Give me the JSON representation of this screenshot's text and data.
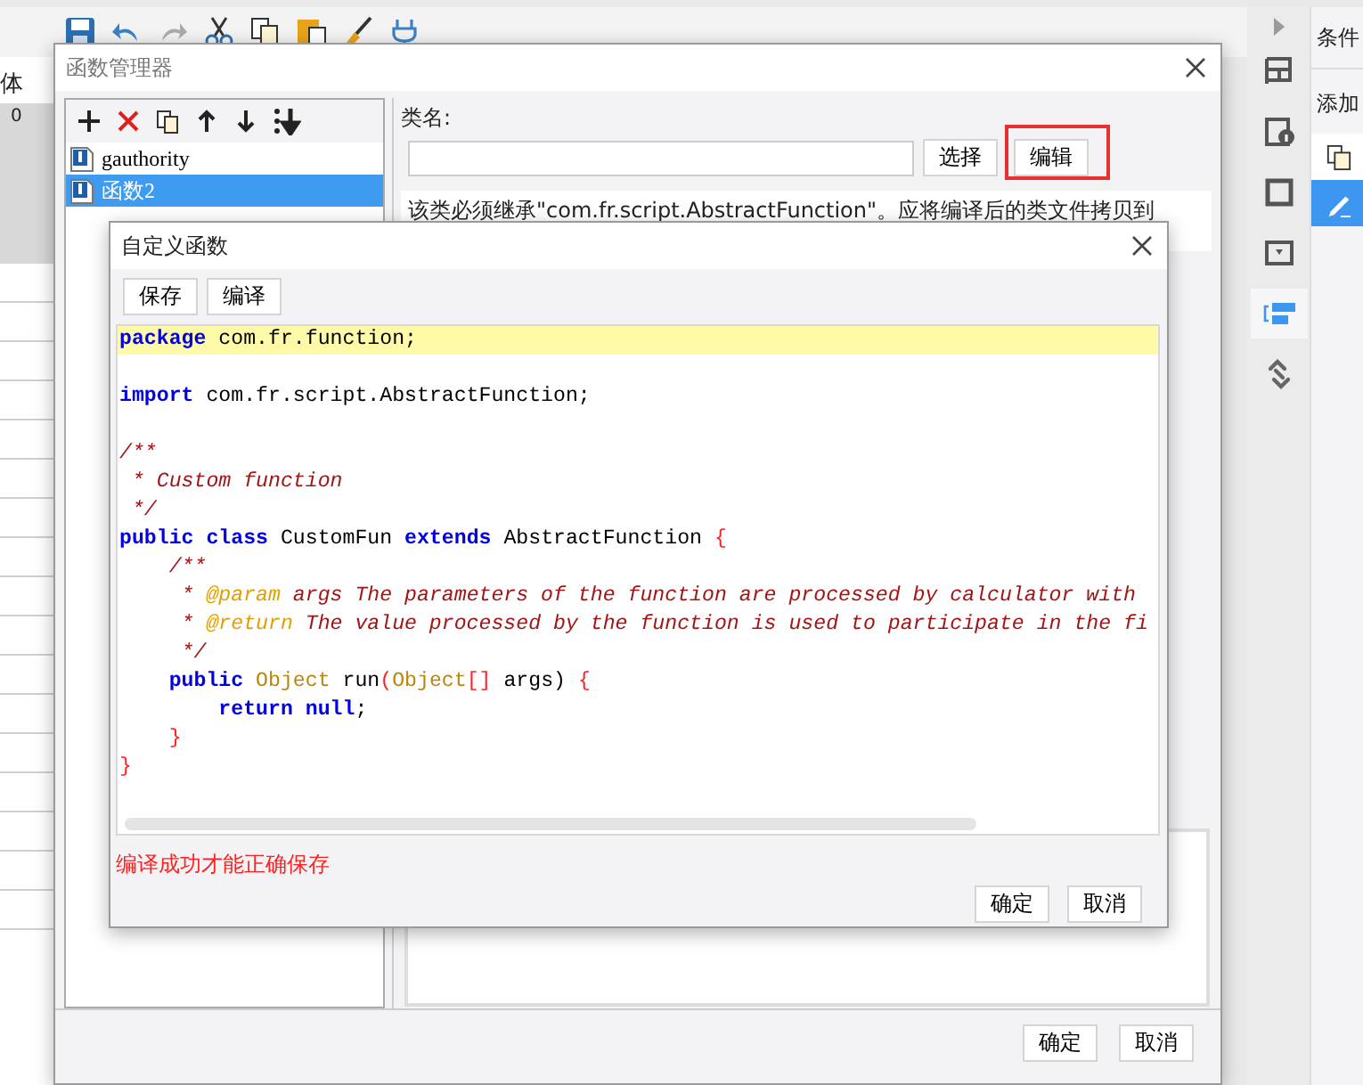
{
  "left_panel": {
    "label": "体",
    "ruler_mark": "0"
  },
  "sidebar": {
    "items": [
      {
        "kind": "frame",
        "selected": false
      },
      {
        "kind": "info",
        "selected": false
      },
      {
        "kind": "square",
        "selected": false
      },
      {
        "kind": "dropdown",
        "selected": false
      },
      {
        "kind": "bars",
        "selected": true
      },
      {
        "kind": "link",
        "selected": false
      }
    ]
  },
  "right_panel": {
    "tab": "条件",
    "label": "添加",
    "items": [
      {
        "kind": "copy",
        "selected": false
      },
      {
        "kind": "edit",
        "selected": true
      }
    ]
  },
  "function_manager": {
    "title": "函数管理器",
    "functions": [
      {
        "name": "gauthority",
        "selected": false
      },
      {
        "name": "函数2",
        "selected": true
      }
    ],
    "class_label": "类名:",
    "select_button": "选择",
    "edit_button": {
      "label": "编辑",
      "highlighted": true
    },
    "description": "该类必须继承\"com.fr.script.AbstractFunction\"。应将编译后的类文件拷贝到",
    "buttons": [
      "确定",
      "取消"
    ]
  },
  "custom_function": {
    "title": "自定义函数",
    "toolbar": [
      "保存",
      "编译"
    ],
    "code_lines": [
      {
        "highlighted": true,
        "tokens": [
          {
            "kind": "keyword",
            "text": "package"
          },
          {
            "kind": "plain",
            "text": " com.fr.function;"
          }
        ]
      },
      {
        "highlighted": false
      },
      {
        "highlighted": false,
        "tokens": [
          {
            "kind": "keyword",
            "text": "import"
          },
          {
            "kind": "plain",
            "text": " com.fr.script.AbstractFunction;"
          }
        ]
      },
      {
        "highlighted": false
      },
      {
        "highlighted": false,
        "tokens": [
          {
            "kind": "comment",
            "text": "/**"
          }
        ]
      },
      {
        "highlighted": false,
        "tokens": [
          {
            "kind": "comment",
            "text": " * Custom function"
          }
        ]
      },
      {
        "highlighted": false,
        "tokens": [
          {
            "kind": "comment",
            "text": " */"
          }
        ]
      },
      {
        "highlighted": false,
        "tokens": [
          {
            "kind": "keyword",
            "text": "public class"
          },
          {
            "kind": "plain",
            "text": " CustomFun "
          },
          {
            "kind": "keyword",
            "text": "extends"
          },
          {
            "kind": "plain",
            "text": " AbstractFunction "
          },
          {
            "kind": "brace",
            "text": "{"
          }
        ]
      },
      {
        "highlighted": false,
        "tokens": [
          {
            "kind": "comment",
            "text": "    /**"
          }
        ]
      },
      {
        "highlighted": false,
        "tokens": [
          {
            "kind": "comment",
            "text": "     * "
          },
          {
            "kind": "doctag",
            "text": "@param"
          },
          {
            "kind": "comment",
            "text": " args The parameters of the function are processed by calculator with"
          }
        ]
      },
      {
        "highlighted": false,
        "tokens": [
          {
            "kind": "comment",
            "text": "     * "
          },
          {
            "kind": "doctag",
            "text": "@return"
          },
          {
            "kind": "comment",
            "text": " The value processed by the function is used to participate in the fi"
          }
        ]
      },
      {
        "highlighted": false,
        "tokens": [
          {
            "kind": "comment",
            "text": "     */"
          }
        ]
      },
      {
        "highlighted": false,
        "tokens": [
          {
            "kind": "keyword",
            "text": "    public "
          },
          {
            "kind": "type",
            "text": "Object"
          },
          {
            "kind": "plain",
            "text": " run"
          },
          {
            "kind": "brace",
            "text": "("
          },
          {
            "kind": "type",
            "text": "Object"
          },
          {
            "kind": "brace",
            "text": "[]"
          },
          {
            "kind": "plain",
            "text": " args) "
          },
          {
            "kind": "brace",
            "text": "{"
          }
        ]
      },
      {
        "highlighted": false,
        "tokens": [
          {
            "kind": "keyword",
            "text": "        return null"
          },
          {
            "kind": "plain",
            "text": ";"
          }
        ]
      },
      {
        "highlighted": false,
        "tokens": [
          {
            "kind": "brace",
            "text": "    }"
          }
        ]
      },
      {
        "highlighted": false,
        "tokens": [
          {
            "kind": "brace",
            "text": "}"
          }
        ]
      }
    ],
    "message": "编译成功才能正确保存",
    "buttons": [
      "确定",
      "取消"
    ]
  }
}
